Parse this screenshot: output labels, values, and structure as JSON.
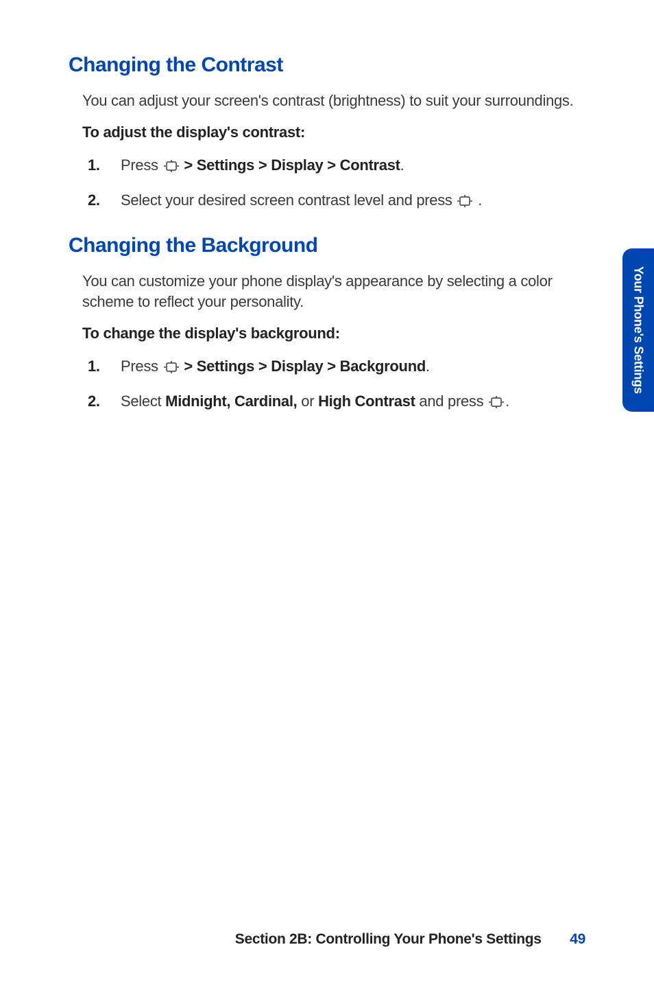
{
  "section_contrast": {
    "heading": "Changing the Contrast",
    "intro": "You can adjust your screen's contrast (brightness) to suit your surroundings.",
    "subhead": "To adjust the display's contrast:",
    "steps": [
      {
        "num": "1.",
        "prefix": "Press ",
        "bold": " > Settings > Display > Contrast",
        "suffix": "."
      },
      {
        "num": "2.",
        "prefix": "Select your desired screen contrast level and press ",
        "bold": "",
        "suffix": " ."
      }
    ]
  },
  "section_background": {
    "heading": "Changing the Background",
    "intro": "You can customize your phone display's appearance by selecting a color scheme to reflect your personality.",
    "subhead": "To change the display's background:",
    "steps": [
      {
        "num": "1.",
        "prefix": "Press ",
        "bold": " > Settings > Display > Background",
        "suffix": "."
      },
      {
        "num": "2.",
        "prefix": "Select ",
        "bold_a": "Midnight, Cardinal,",
        "mid": " or ",
        "bold_b": "High Contrast",
        "suffix": " and press ",
        "suffix2": "."
      }
    ]
  },
  "side_tab": "Your Phone's Settings",
  "footer": {
    "text": "Section 2B: Controlling Your Phone's Settings",
    "page": "49"
  }
}
